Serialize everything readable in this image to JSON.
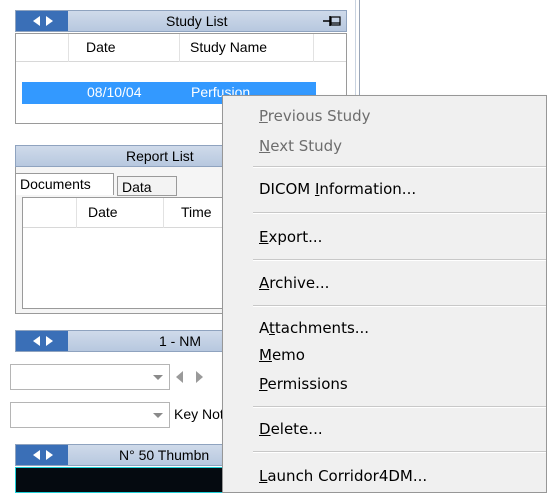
{
  "study_list": {
    "title": "Study List",
    "pin_icon": "pin-icon",
    "columns": [
      "Date",
      "Study Name"
    ],
    "rows": [
      {
        "date": "08/10/04",
        "name": "Perfusion"
      }
    ]
  },
  "report_list": {
    "title": "Report List",
    "tabs": [
      "Documents",
      "Data"
    ],
    "columns": [
      "Date",
      "Time"
    ]
  },
  "series_panel": {
    "title": "1 - NM",
    "keynote_label": "Key Note"
  },
  "thumb_panel": {
    "title": "N° 50 Thumbn"
  },
  "context_menu": {
    "items": [
      {
        "label": "Previous Study",
        "mnemonic": "P",
        "disabled": true
      },
      {
        "label": "Next Study",
        "mnemonic": "N",
        "disabled": true
      },
      {
        "label": "DICOM Information...",
        "mnemonic": "I",
        "disabled": false
      },
      {
        "label": "Export...",
        "mnemonic": "E",
        "disabled": false
      },
      {
        "label": "Archive...",
        "mnemonic": "A",
        "disabled": false
      },
      {
        "label": "Attachments...",
        "mnemonic": "t",
        "disabled": false
      },
      {
        "label": "Memo",
        "mnemonic": "M",
        "disabled": false
      },
      {
        "label": "Permissions",
        "mnemonic": "P",
        "disabled": false
      },
      {
        "label": "Delete...",
        "mnemonic": "D",
        "disabled": false
      },
      {
        "label": "Launch Corridor4DM...",
        "mnemonic": "L",
        "disabled": false
      }
    ]
  },
  "colors": {
    "selection": "#3399ff",
    "titlebar_arrows": "#3a6fb7",
    "menu_background": "#f0f0f0",
    "disabled_text": "#6d6d6d"
  }
}
